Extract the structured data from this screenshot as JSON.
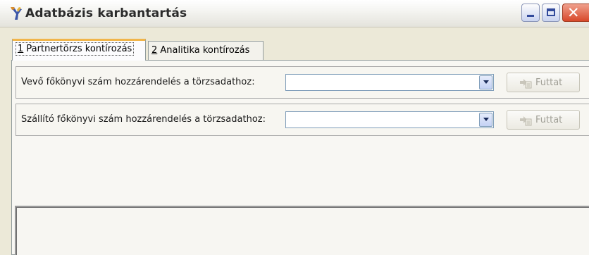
{
  "window": {
    "title": "Adatbázis karbantartás",
    "icon": "app-icon",
    "controls": {
      "minimize": "minimize-icon",
      "maximize": "maximize-icon",
      "close": "close-icon"
    }
  },
  "tabs": [
    {
      "accel": "1",
      "label": " Partnertörzs kontírozás",
      "active": true
    },
    {
      "accel": "2",
      "label": " Analitika kontírozás",
      "active": false
    }
  ],
  "rows": [
    {
      "label": "Vevő főkönyvi szám hozzárendelés a törzsadathoz:",
      "select_value": "",
      "run_label": "Futtat"
    },
    {
      "label": "Szállító főkönyvi szám hozzárendelés a törzsadathoz:",
      "select_value": "",
      "run_label": "Futtat"
    }
  ],
  "colors": {
    "tab_highlight": "#f1b54a",
    "disabled_text": "#a09f96",
    "window_bg": "#ece9d8"
  }
}
